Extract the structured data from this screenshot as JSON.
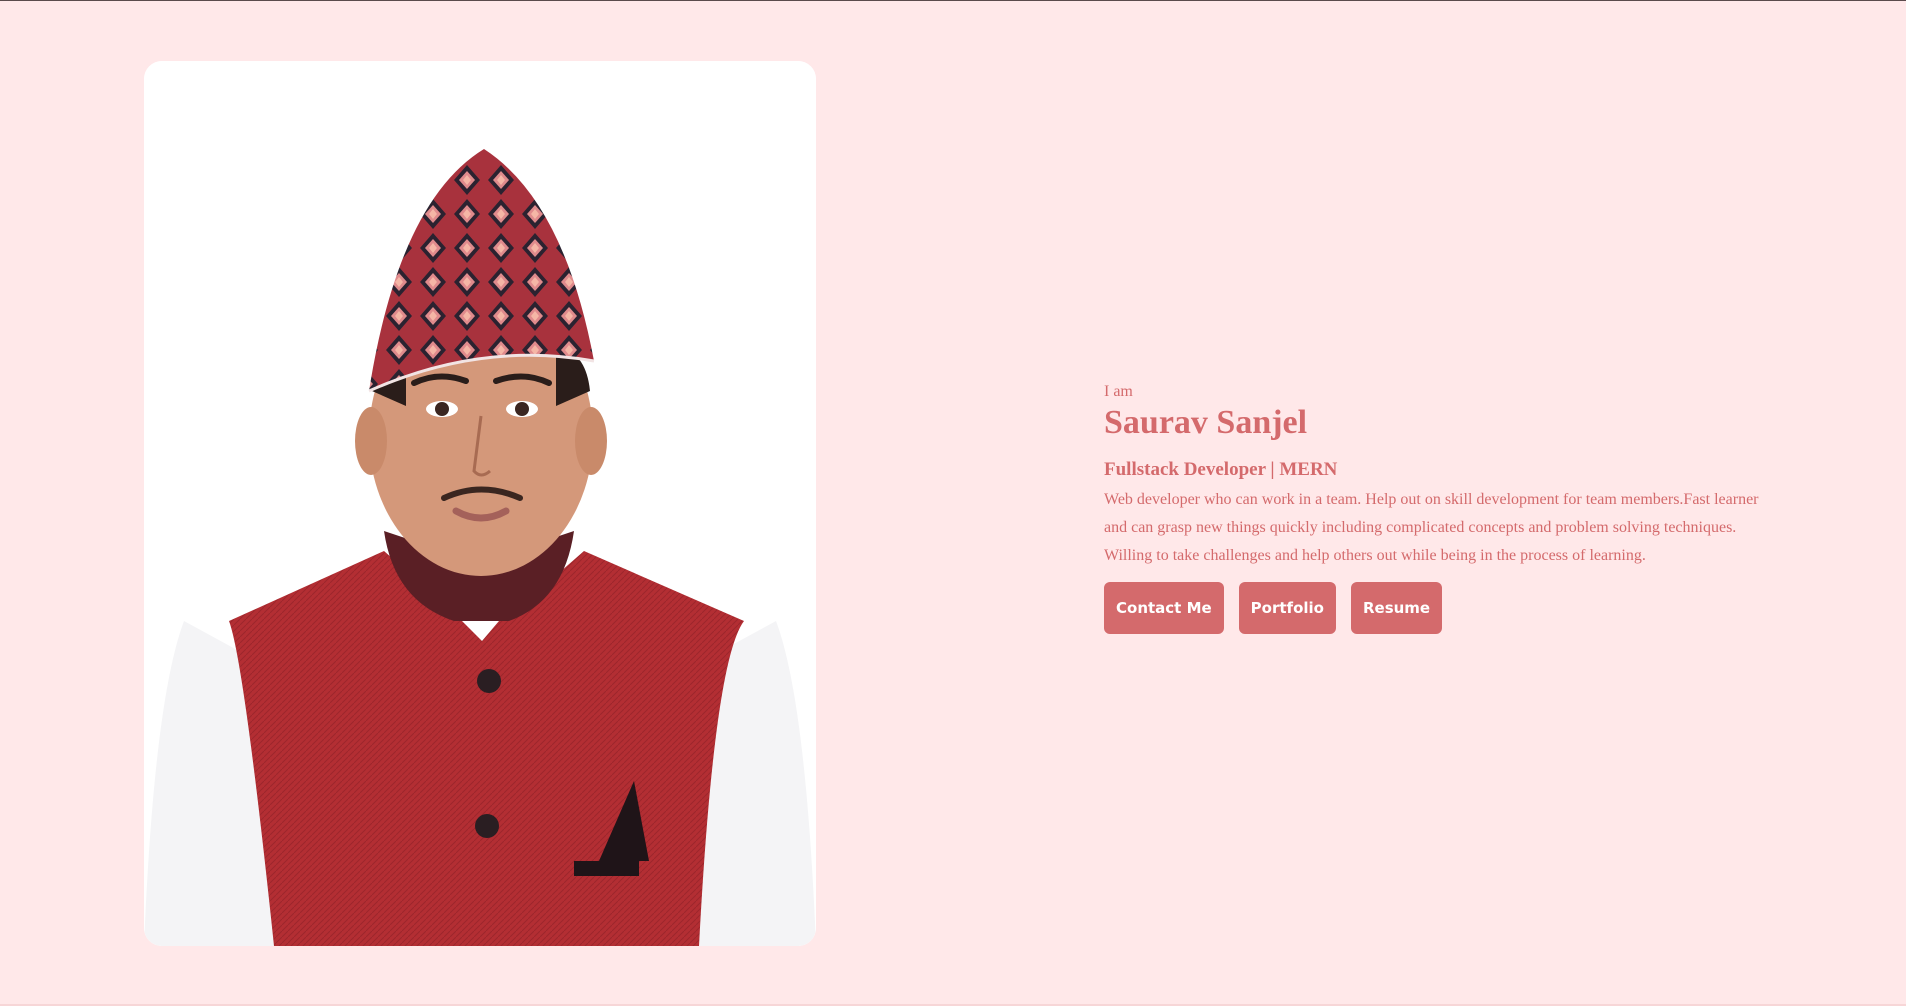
{
  "hero": {
    "greeting": "I am",
    "name": "Saurav Sanjel",
    "role": "Fullstack Developer | MERN",
    "bio": "Web developer who can work in a team. Help out on skill development for team members.Fast learner and can grasp new things quickly including complicated concepts and problem solving techniques. Willing to take challenges and help others out while being in the process of learning."
  },
  "actions": {
    "contact_label": "Contact Me",
    "portfolio_label": "Portfolio",
    "resume_label": "Resume"
  },
  "colors": {
    "page_background": "#ffe8e9",
    "accent": "#d46a6c",
    "button_text": "#ffffff"
  }
}
